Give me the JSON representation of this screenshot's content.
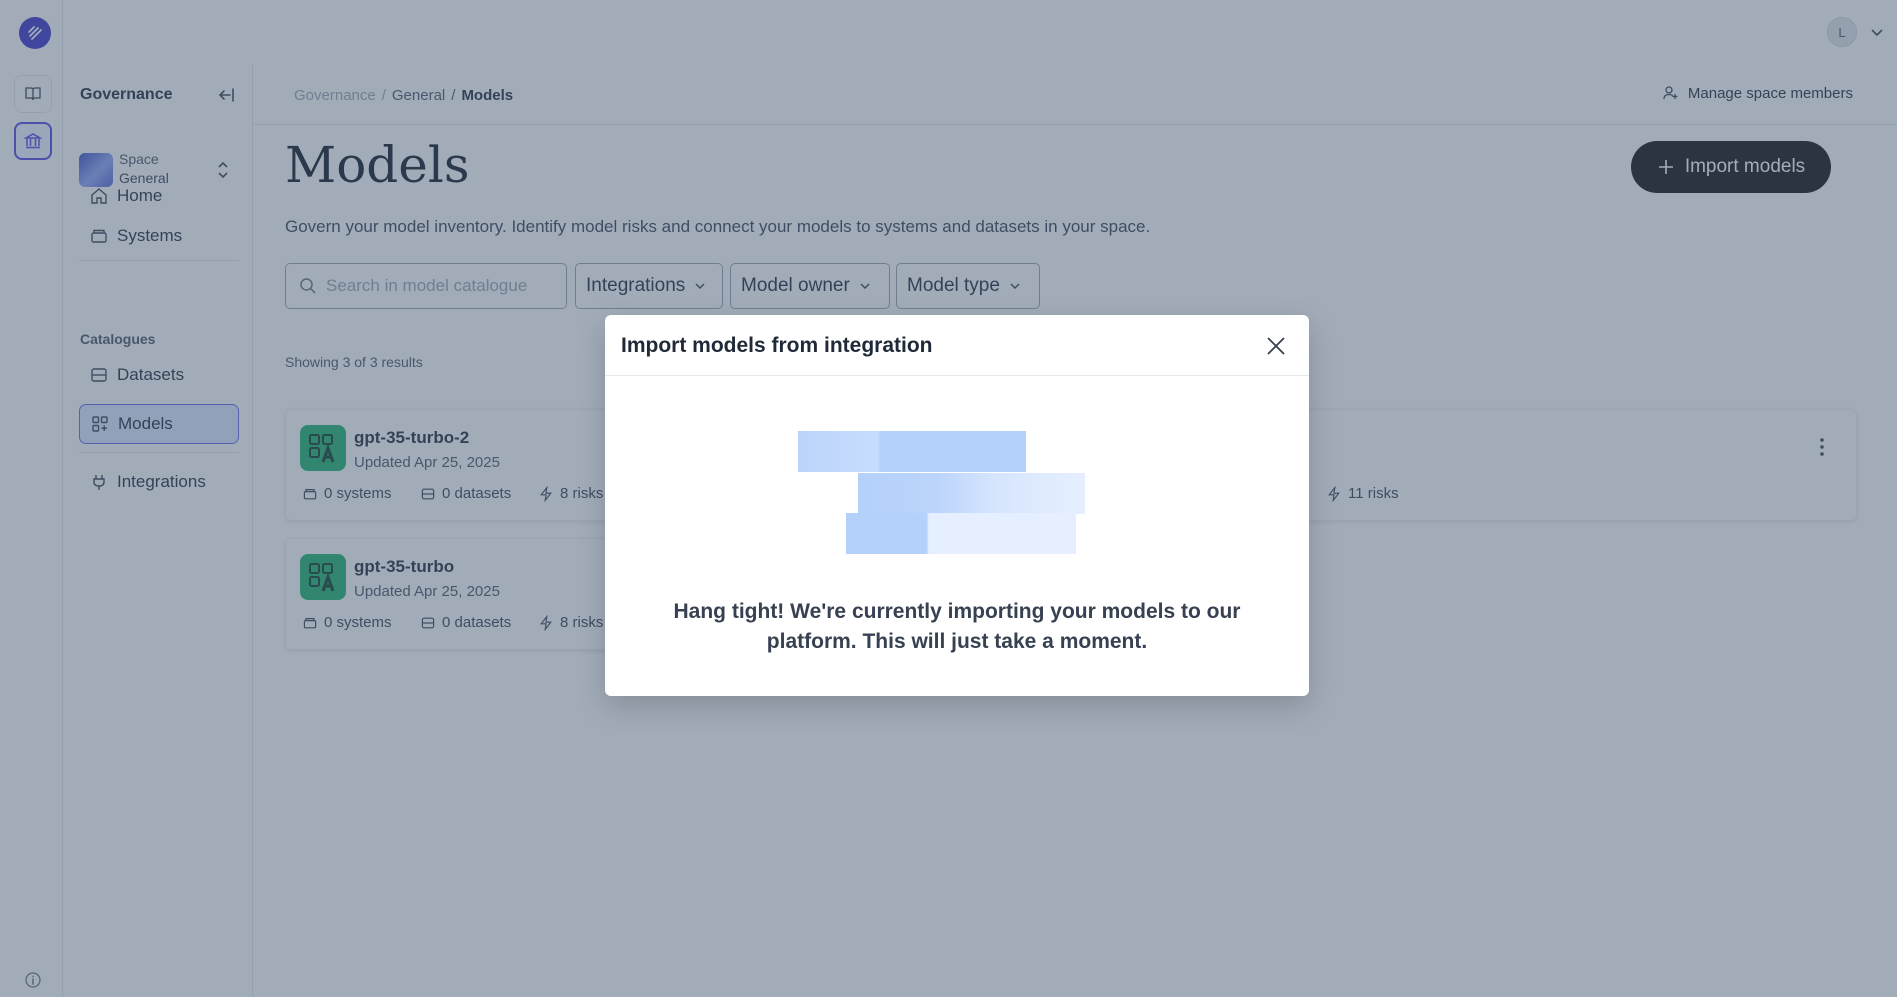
{
  "app": {
    "user_initial": "L"
  },
  "panel": {
    "title": "Governance",
    "space_label": "Space",
    "space_name": "General",
    "nav": [
      {
        "label": "Home"
      },
      {
        "label": "Systems"
      }
    ],
    "catalogues_heading": "Catalogues",
    "catalogues": [
      {
        "label": "Datasets"
      },
      {
        "label": "Models"
      }
    ],
    "integrations_label": "Integrations"
  },
  "header": {
    "breadcrumb": [
      "Governance",
      "General",
      "Models"
    ],
    "breadcrumb_sep": "/",
    "manage_label": "Manage space members"
  },
  "main": {
    "title": "Models",
    "import_label": "Import models",
    "subtitle": "Govern your model inventory. Identify model risks and connect your models to systems and datasets in your space.",
    "search_placeholder": "Search in model catalogue",
    "filters": [
      "Integrations",
      "Model owner",
      "Model type"
    ],
    "results_text": "Showing 3 of 3 results"
  },
  "cards": [
    {
      "name": "gpt-35-turbo-2",
      "updated": "Updated Apr 25, 2025",
      "systems": "0 systems",
      "datasets": "0 datasets",
      "risks": "8 risks",
      "extra_risks": "11 risks"
    },
    {
      "name": "gpt-35-turbo",
      "updated": "Updated Apr 25, 2025",
      "systems": "0 systems",
      "datasets": "0 datasets",
      "risks": "8 risks"
    }
  ],
  "modal": {
    "title": "Import models from integration",
    "message": "Hang tight! We're currently importing your models to our platform. This will just take a moment."
  },
  "colors": {
    "brand": "#3b30c7",
    "accent": "#4f46e5",
    "primary_button": "#111111",
    "model_icon": "#1fb36c",
    "loader": "#b3d1fb"
  },
  "icons": {
    "rail": [
      "logo-icon",
      "book-icon",
      "bank-icon",
      "info-icon"
    ],
    "nav": [
      "home-icon",
      "systems-icon",
      "datasets-icon",
      "models-icon",
      "plug-icon"
    ]
  }
}
